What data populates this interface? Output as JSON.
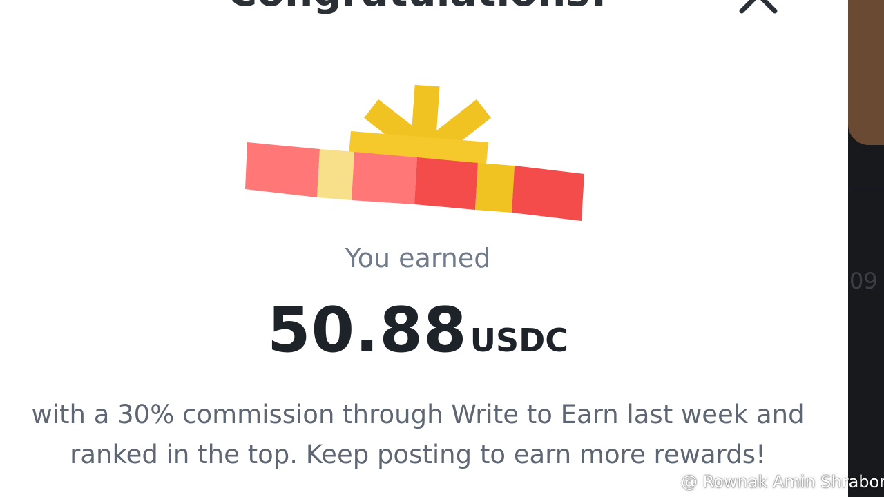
{
  "modal": {
    "title": "Congratulations!",
    "earned_label": "You earned",
    "amount": "50.88",
    "currency": "USDC",
    "description": "with a 30% commission through Write to Earn last week and ranked in the top. Keep posting to earn more rewards!"
  },
  "side_panel": {
    "number_fragment": "09"
  },
  "watermark": {
    "text": "@ Rownak Amin Shrabon",
    "logo": "binance-logo-icon"
  },
  "icons": {
    "close": "close-icon",
    "gift": "gift-icon"
  },
  "colors": {
    "title_text": "#2b2f36",
    "amount_text": "#1e2329",
    "muted_text": "#707a8a",
    "gift_yellow": "#f0c322",
    "gift_red": "#f44b4b",
    "gift_pink": "#ff7777",
    "gift_light_yellow": "#f8df8a"
  }
}
